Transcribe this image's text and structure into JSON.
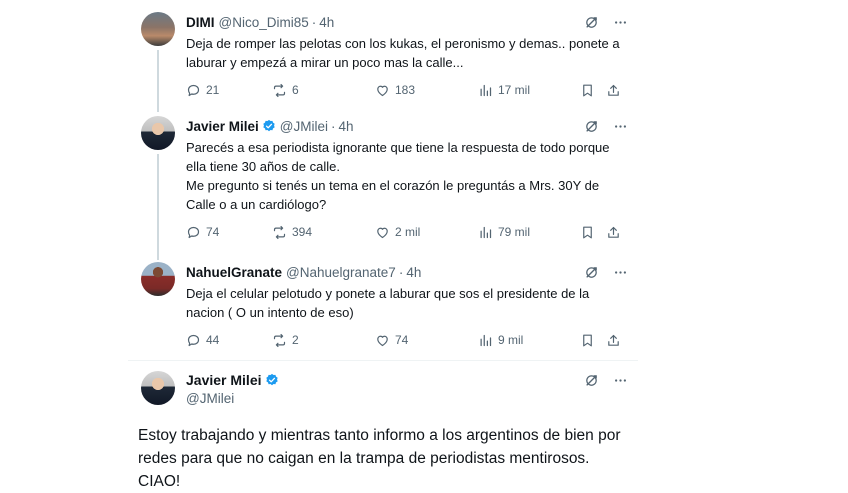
{
  "tweets": [
    {
      "name": "DIMI",
      "handle": "@Nico_Dimi85",
      "time": "4h",
      "verified": false,
      "avatar": "dimi-avatar",
      "text": "Deja de romper las pelotas con los kukas, el peronismo y demas.. ponete a laburar y empezá a mirar un poco mas la calle...",
      "replies": "21",
      "retweets": "6",
      "likes": "183",
      "views": "17 mil"
    },
    {
      "name": "Javier Milei",
      "handle": "@JMilei",
      "time": "4h",
      "verified": true,
      "avatar": "milei-avatar",
      "text": "Parecés a esa periodista ignorante que tiene la respuesta de todo porque ella tiene 30 años de calle.\nMe pregunto si tenés un tema en el corazón le preguntás a Mrs. 30Y de Calle o a un cardiólogo?",
      "replies": "74",
      "retweets": "394",
      "likes": "2 mil",
      "views": "79 mil"
    },
    {
      "name": "NahuelGranate",
      "handle": "@Nahuelgranate7",
      "time": "4h",
      "verified": false,
      "avatar": "nahuel-avatar",
      "text": "Deja el celular pelotudo y ponete a laburar que sos el presidente de la nacion ( O un intento de eso)",
      "replies": "44",
      "retweets": "2",
      "likes": "74",
      "views": "9 mil"
    }
  ],
  "main_tweet": {
    "name": "Javier Milei",
    "handle": "@JMilei",
    "verified": true,
    "text": "Estoy trabajando y mientras tanto informo a los argentinos de bien por redes para que no caigan en la trampa de periodistas mentirosos.\nCIAO!"
  },
  "icons": {
    "grok": "grok-icon",
    "more": "more-icon",
    "reply": "reply-icon",
    "retweet": "retweet-icon",
    "like": "heart-icon",
    "views": "views-icon",
    "bookmark": "bookmark-icon",
    "share": "share-icon"
  },
  "colors": {
    "verified": "#1d9bf0",
    "text": "#0f1419",
    "secondary": "#536471",
    "thread_line": "#cfd9de"
  }
}
